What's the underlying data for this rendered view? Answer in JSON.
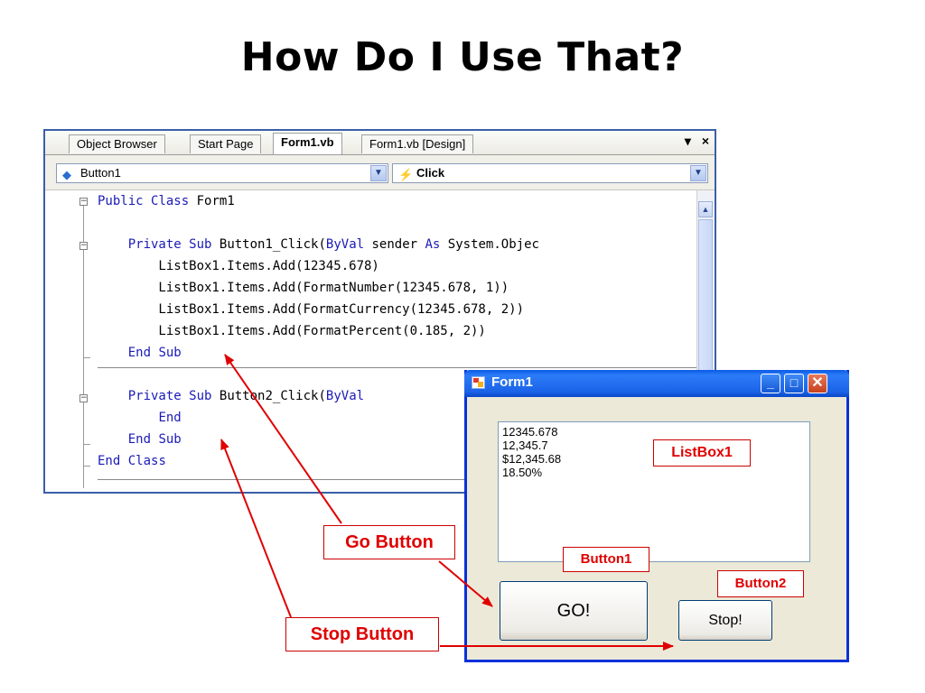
{
  "slide": {
    "title": "How Do I Use That?"
  },
  "ide": {
    "tabs": [
      "Object Browser",
      "Start Page",
      "Form1.vb",
      "Form1.vb [Design]"
    ],
    "active_tab": "Form1.vb",
    "tab_controls": {
      "dropdown": "▾",
      "close": "×"
    },
    "object_dropdown": "Button1",
    "event_dropdown": "Click",
    "code_lines": [
      [
        {
          "t": "Public",
          "k": true
        },
        {
          "t": " "
        },
        {
          "t": "Class",
          "k": true
        },
        {
          "t": " Form1"
        }
      ],
      [],
      [
        {
          "t": "    "
        },
        {
          "t": "Private",
          "k": true
        },
        {
          "t": " "
        },
        {
          "t": "Sub",
          "k": true
        },
        {
          "t": " Button1_Click("
        },
        {
          "t": "ByVal",
          "k": true
        },
        {
          "t": " sender "
        },
        {
          "t": "As",
          "k": true
        },
        {
          "t": " System.Objec"
        }
      ],
      [
        {
          "t": "        ListBox1.Items.Add(12345.678)"
        }
      ],
      [
        {
          "t": "        ListBox1.Items.Add(FormatNumber(12345.678, 1))"
        }
      ],
      [
        {
          "t": "        ListBox1.Items.Add(FormatCurrency(12345.678, 2))"
        }
      ],
      [
        {
          "t": "        ListBox1.Items.Add(FormatPercent(0.185, 2))"
        }
      ],
      [
        {
          "t": "    "
        },
        {
          "t": "End",
          "k": true
        },
        {
          "t": " "
        },
        {
          "t": "Sub",
          "k": true
        }
      ],
      [],
      [
        {
          "t": "    "
        },
        {
          "t": "Private",
          "k": true
        },
        {
          "t": " "
        },
        {
          "t": "Sub",
          "k": true
        },
        {
          "t": " Button2_Click("
        },
        {
          "t": "ByVal",
          "k": true
        }
      ],
      [
        {
          "t": "        "
        },
        {
          "t": "End",
          "k": true
        }
      ],
      [
        {
          "t": "    "
        },
        {
          "t": "End",
          "k": true
        },
        {
          "t": " "
        },
        {
          "t": "Sub",
          "k": true
        }
      ],
      [
        {
          "t": "End",
          "k": true
        },
        {
          "t": " "
        },
        {
          "t": "Class",
          "k": true
        }
      ]
    ]
  },
  "form": {
    "title": "Form1",
    "listbox_items": [
      "12345.678",
      "12,345.7",
      "$12,345.68",
      "18.50%"
    ],
    "go_label": "GO!",
    "stop_label": "Stop!",
    "window_buttons": {
      "minimize": "_",
      "maximize": "□",
      "close": "✕"
    }
  },
  "annotations": {
    "listbox": "ListBox1",
    "button1": "Button1",
    "button2": "Button2",
    "go": "Go Button",
    "stop": "Stop Button"
  },
  "colors": {
    "keyword": "#1a1ab8",
    "annotation": "#e00000",
    "titlebar": "#0a5ae6"
  }
}
